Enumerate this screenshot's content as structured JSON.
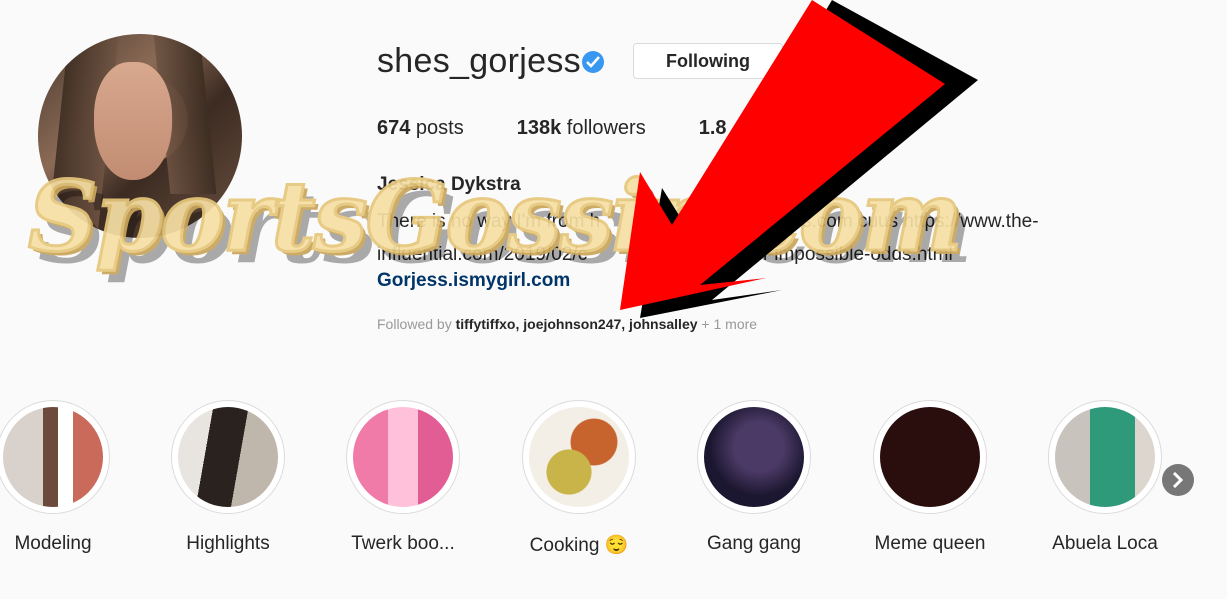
{
  "profile": {
    "username": "shes_gorjess",
    "follow_button": "Following",
    "stats": [
      {
        "count": "674",
        "label": " posts"
      },
      {
        "count": "138k",
        "label": " followers"
      },
      {
        "count": "1.8",
        "label": ""
      }
    ],
    "full_name": "Jessica Dykstra",
    "bio_line1": "There is no way I'm from h",
    "bio_line1b": "gorjess.com cuus https://www.the-",
    "bio_line2": "influential.com/2019/02/c",
    "bio_line2b": "e-of-impossible-odds.html",
    "link": "Gorjess.ismygirl.com",
    "followed_by_prefix": "Followed by ",
    "followed_by_names": "tiffytiffxo, joejohnson247, johnsalley",
    "followed_by_more": " + 1 more"
  },
  "highlights": [
    {
      "label": "Modeling"
    },
    {
      "label": "Highlights"
    },
    {
      "label": "Twerk boo..."
    },
    {
      "label": "Cooking 😌"
    },
    {
      "label": "Gang gang"
    },
    {
      "label": "Meme queen"
    },
    {
      "label": "Abuela Loca"
    }
  ],
  "watermark": "SportsGossip.com",
  "colors": {
    "verified": "#3897f0",
    "link": "#003569",
    "arrow": "#ff0000"
  }
}
